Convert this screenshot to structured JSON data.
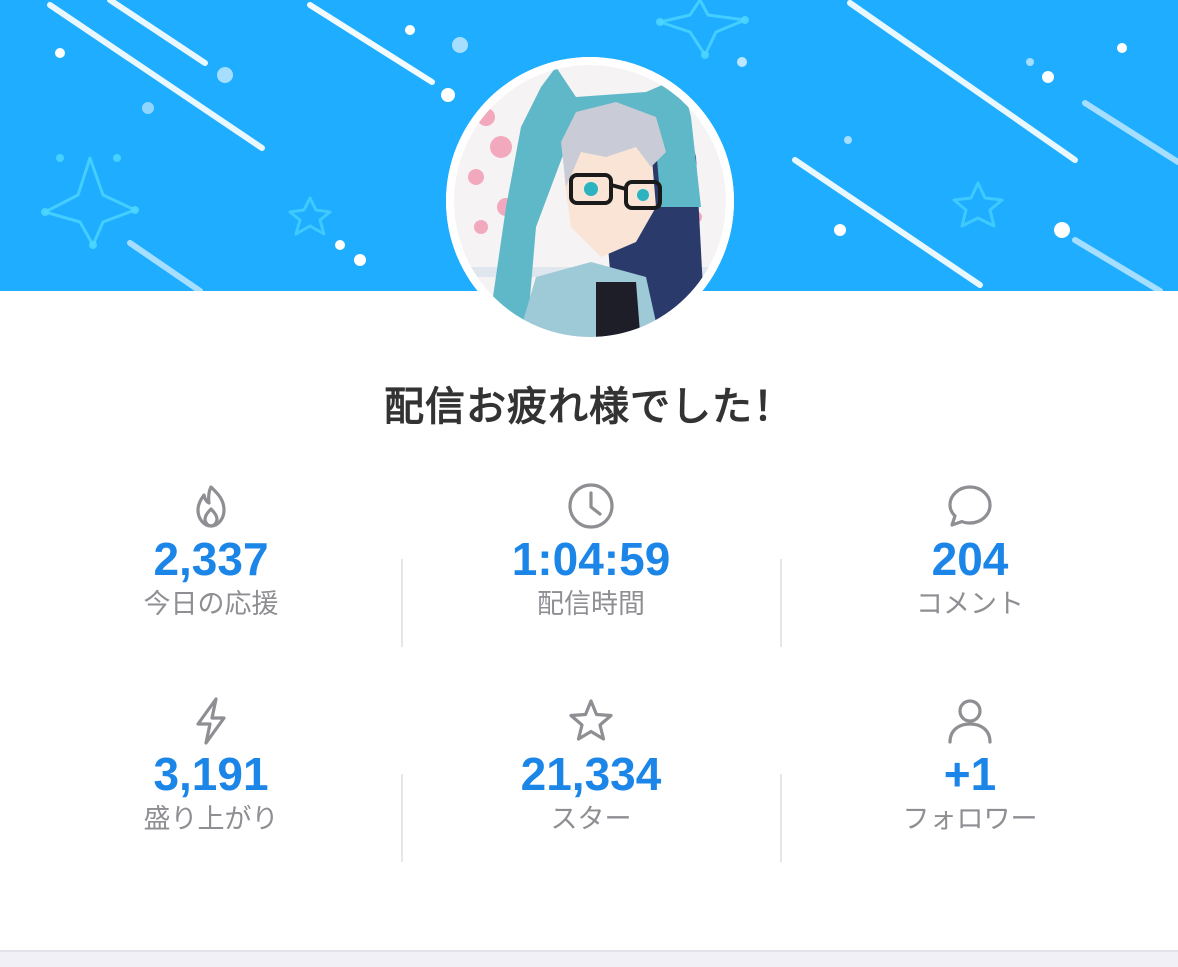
{
  "header": {
    "banner_color": "#1fadff",
    "avatar_alt": "配信者アバター"
  },
  "title": "配信お疲れ様でした！",
  "colors": {
    "value": "#1c86e8",
    "label": "#8e8e93",
    "icon": "#8e8e93"
  },
  "stats": [
    {
      "icon": "flame-icon",
      "value": "2,337",
      "label": "今日の応援"
    },
    {
      "icon": "clock-icon",
      "value": "1:04:59",
      "label": "配信時間"
    },
    {
      "icon": "comment-icon",
      "value": "204",
      "label": "コメント"
    },
    {
      "icon": "lightning-icon",
      "value": "3,191",
      "label": "盛り上がり"
    },
    {
      "icon": "star-icon",
      "value": "21,334",
      "label": "スター"
    },
    {
      "icon": "user-icon",
      "value": "+1",
      "label": "フォロワー"
    }
  ]
}
